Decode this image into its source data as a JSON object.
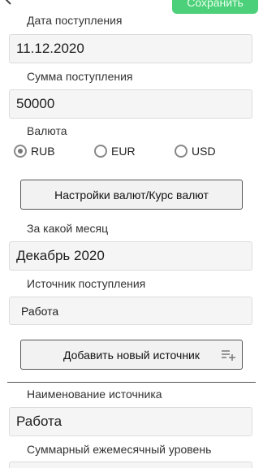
{
  "toolbar": {
    "save_label": "Сохранить"
  },
  "date": {
    "label": "Дата поступления",
    "value": "11.12.2020"
  },
  "amount": {
    "label": "Сумма поступления",
    "value": "50000"
  },
  "currency": {
    "label": "Валюта",
    "options": [
      "RUB",
      "EUR",
      "USD"
    ],
    "selected": "RUB",
    "settings_button": "Настройки валют/Курс валют"
  },
  "month": {
    "label": "За какой месяц",
    "value": "Декабрь 2020"
  },
  "source": {
    "label": "Источник поступления",
    "value": "Работа",
    "add_button": "Добавить новый источник"
  },
  "source_name": {
    "label": "Наименование источника",
    "value": "Работа"
  },
  "monthly_level": {
    "label": "Суммарный ежемесячный уровень"
  }
}
